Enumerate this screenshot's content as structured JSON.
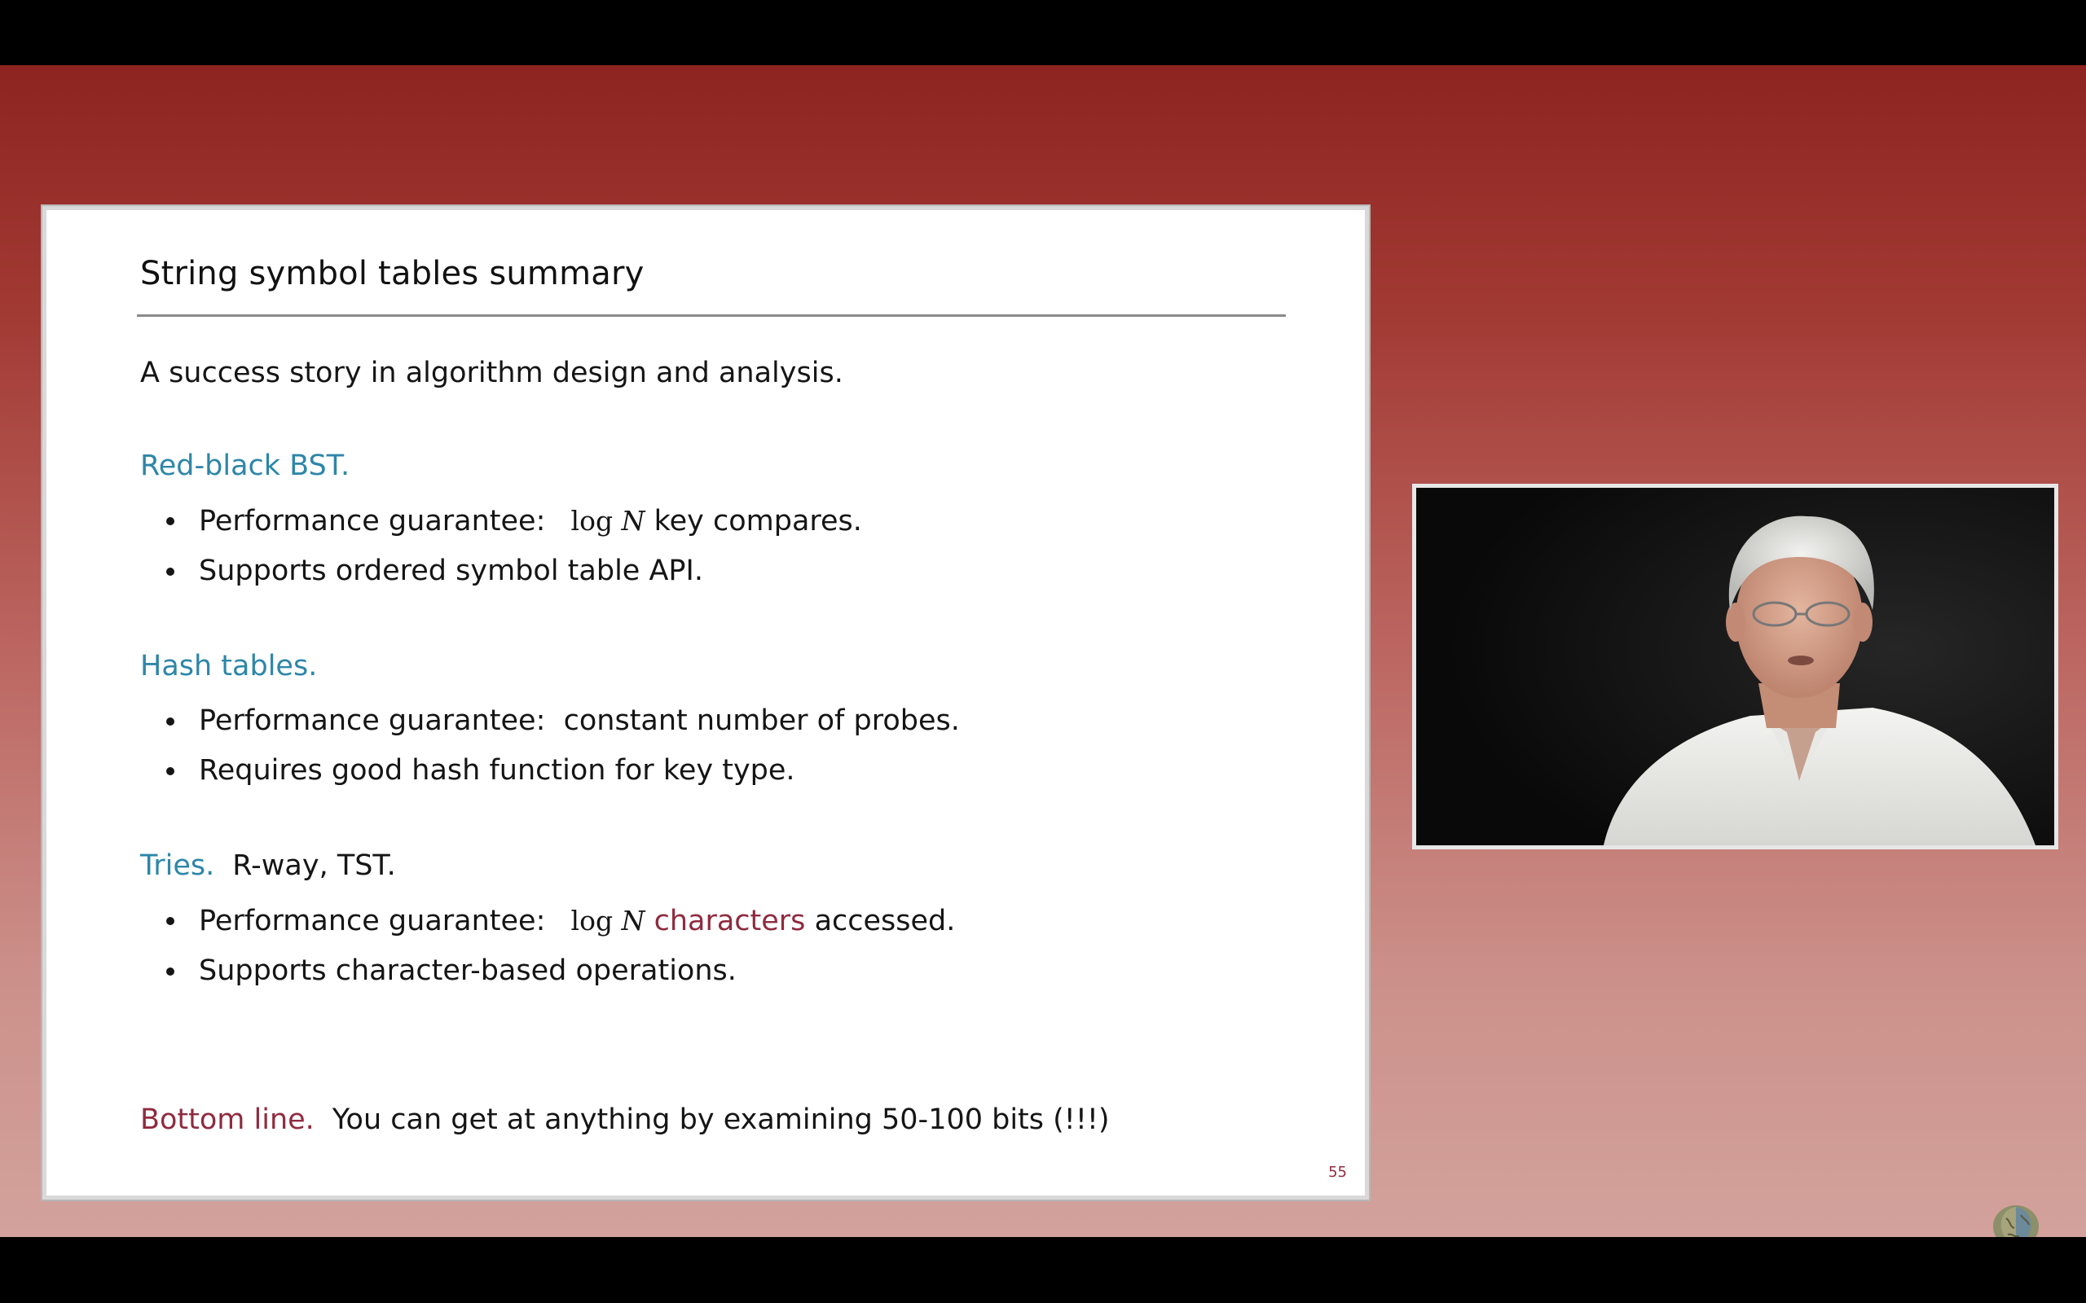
{
  "slide": {
    "title": "String symbol tables summary",
    "lead": "A success story in algorithm design and analysis.",
    "sections": [
      {
        "heading": "Red-black BST.",
        "heading_rest": "",
        "bullets": [
          {
            "pre": "Performance guarantee:",
            "math_pre": "log",
            "math_var": "N",
            "accent": "",
            "post": "key compares."
          },
          {
            "text": "Supports ordered symbol table API."
          }
        ]
      },
      {
        "heading": "Hash tables.",
        "heading_rest": "",
        "bullets": [
          {
            "text": "Performance guarantee:  constant number of probes."
          },
          {
            "text": "Requires good hash function for key type."
          }
        ]
      },
      {
        "heading": "Tries.",
        "heading_rest": "R-way, TST.",
        "bullets": [
          {
            "pre": "Performance guarantee:",
            "math_pre": "log",
            "math_var": "N",
            "accent": "characters",
            "post": "accessed."
          },
          {
            "text": "Supports character-based operations."
          }
        ]
      }
    ],
    "bottom_line": {
      "label": "Bottom line.",
      "text": "You can get at anything by examining 50-100 bits (!!!)"
    },
    "page_number": "55"
  },
  "video": {
    "description_icon": "speaker-video-icon"
  },
  "colors": {
    "section_heading": "#2e86a8",
    "accent": "#8f2b3f",
    "background_top": "#8e2420",
    "background_bottom": "#d3a29c"
  },
  "logo": {
    "icon": "brain-logo-icon"
  }
}
